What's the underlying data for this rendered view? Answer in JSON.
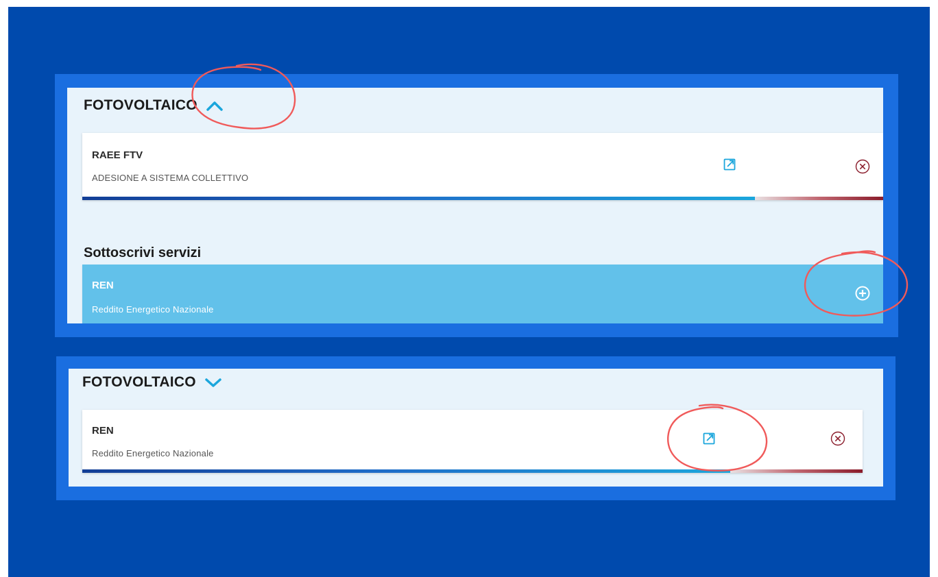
{
  "top_panel": {
    "title": "FOTOVOLTAICO",
    "chevron": "chevron-up-icon",
    "card": {
      "title": "RAEE FTV",
      "subtitle": "ADESIONE A SISTEMA COLLETTIVO",
      "progress_fraction": 0.84,
      "edit_icon": "external-link-icon",
      "remove_icon": "circle-x-icon"
    },
    "subheading": "Sottoscrivi servizi",
    "service": {
      "title": "REN",
      "subtitle": "Reddito Energetico Nazionale",
      "add_icon": "circle-plus-icon"
    }
  },
  "bottom_panel": {
    "title": "FOTOVOLTAICO",
    "chevron": "chevron-down-icon",
    "card": {
      "title": "REN",
      "subtitle": "Reddito Energetico Nazionale",
      "progress_fraction": 0.83,
      "edit_icon": "external-link-icon",
      "remove_icon": "circle-x-icon"
    }
  },
  "colors": {
    "background": "#004aad",
    "frame": "#1a6ee0",
    "panel": "#e8f3fb",
    "accent": "#1ba6dc",
    "service": "#62c1ea",
    "annotation": "#f05a5a"
  }
}
